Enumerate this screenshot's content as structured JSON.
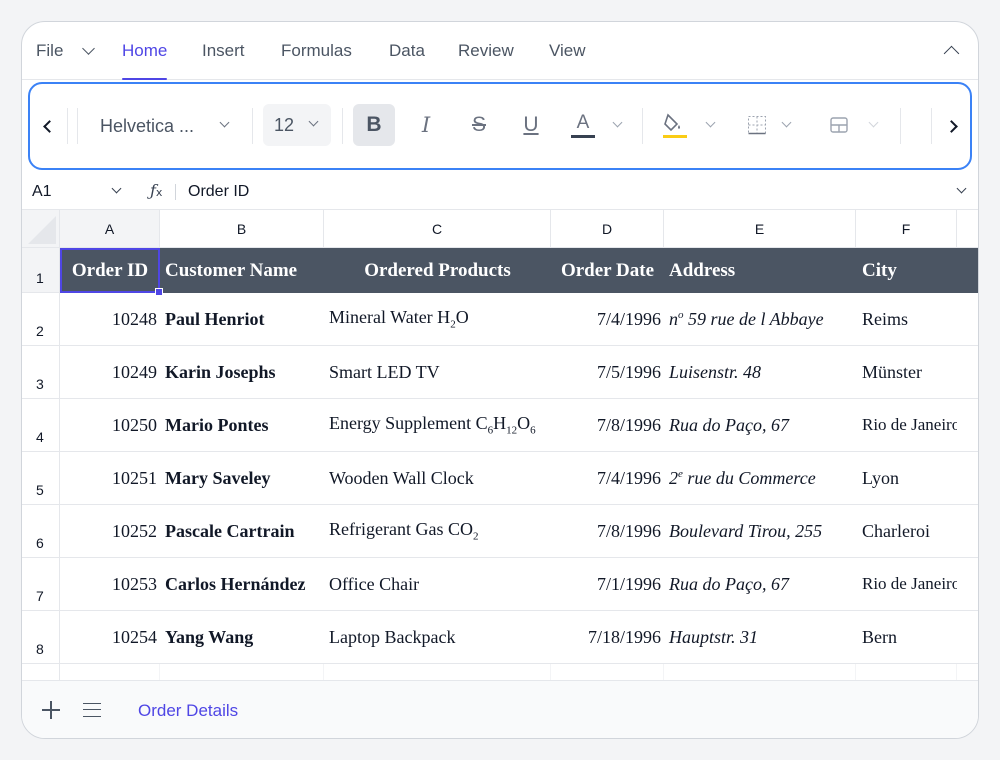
{
  "ribbon": {
    "tabs": [
      "File",
      "Home",
      "Insert",
      "Formulas",
      "Data",
      "Review",
      "View"
    ],
    "active_tab": "Home"
  },
  "toolbar": {
    "font_name": "Helvetica ...",
    "font_size": "12",
    "bold_glyph": "B",
    "italic_glyph": "I",
    "strike_glyph": "S",
    "underline_glyph": "U",
    "font_color_glyph": "A",
    "font_color": "#374151",
    "fill_color": "#facc15",
    "icons": [
      "chevron-left-icon",
      "bold-icon",
      "italic-icon",
      "strikethrough-icon",
      "underline-icon",
      "font-color-icon",
      "fill-color-icon",
      "borders-icon",
      "merge-cells-icon",
      "chevron-right-icon"
    ]
  },
  "formula_bar": {
    "cell_ref": "A1",
    "fx": "fx",
    "value": "Order ID"
  },
  "sheet": {
    "columns": [
      "A",
      "B",
      "C",
      "D",
      "E",
      "F"
    ],
    "rows": [
      "1",
      "2",
      "3",
      "4",
      "5",
      "6",
      "7",
      "8"
    ],
    "header": {
      "order_id": "Order ID",
      "customer": "Customer Name",
      "products": "Ordered Products",
      "date": "Order Date",
      "address": "Address",
      "city": "City"
    },
    "data": [
      {
        "order_id": "10248",
        "customer": "Paul Henriot",
        "product": "Mineral Water H",
        "sub1": "2",
        "tail1": "O",
        "sub2": "",
        "tail2": "",
        "sub3": "",
        "date": "7/4/1996",
        "addr_pre": "n",
        "addr_sup": "o",
        "addr_rest": " 59 rue de l Abbaye",
        "city": "Reims"
      },
      {
        "order_id": "10249",
        "customer": "Karin Josephs",
        "product": "Smart LED TV",
        "sub1": "",
        "tail1": "",
        "sub2": "",
        "tail2": "",
        "sub3": "",
        "date": "7/5/1996",
        "addr_pre": "Luisenstr. 48",
        "addr_sup": "",
        "addr_rest": "",
        "city": "Münster"
      },
      {
        "order_id": "10250",
        "customer": "Mario Pontes",
        "product": "Energy Supplement C",
        "sub1": "6",
        "tail1": "H",
        "sub2": "12",
        "tail2": "O",
        "sub3": "6",
        "date": "7/8/1996",
        "addr_pre": "Rua do Paço, 67",
        "addr_sup": "",
        "addr_rest": "",
        "city": "Rio de Janeiro"
      },
      {
        "order_id": "10251",
        "customer": "Mary Saveley",
        "product": "Wooden Wall Clock",
        "sub1": "",
        "tail1": "",
        "sub2": "",
        "tail2": "",
        "sub3": "",
        "date": "7/4/1996",
        "addr_pre": "2",
        "addr_sup": "e",
        "addr_rest": " rue du Commerce",
        "city": "Lyon"
      },
      {
        "order_id": "10252",
        "customer": "Pascale Cartrain",
        "product": "Refrigerant Gas CO",
        "sub1": "2",
        "tail1": "",
        "sub2": "",
        "tail2": "",
        "sub3": "",
        "date": "7/8/1996",
        "addr_pre": "Boulevard Tirou, 255",
        "addr_sup": "",
        "addr_rest": "",
        "city": "Charleroi"
      },
      {
        "order_id": "10253",
        "customer": "Carlos Hernández",
        "product": "Office Chair",
        "sub1": "",
        "tail1": "",
        "sub2": "",
        "tail2": "",
        "sub3": "",
        "date": "7/1/1996",
        "addr_pre": "Rua do Paço, 67",
        "addr_sup": "",
        "addr_rest": "",
        "city": "Rio de Janeiro"
      },
      {
        "order_id": "10254",
        "customer": "Yang Wang",
        "product": "Laptop Backpack",
        "sub1": "",
        "tail1": "",
        "sub2": "",
        "tail2": "",
        "sub3": "",
        "date": "7/18/1996",
        "addr_pre": "Hauptstr. 31",
        "addr_sup": "",
        "addr_rest": "",
        "city": "Bern"
      }
    ],
    "header_bg": "#4b5563",
    "selection_color": "#4f46e5"
  },
  "sheet_tabs": {
    "active": "Order Details"
  }
}
